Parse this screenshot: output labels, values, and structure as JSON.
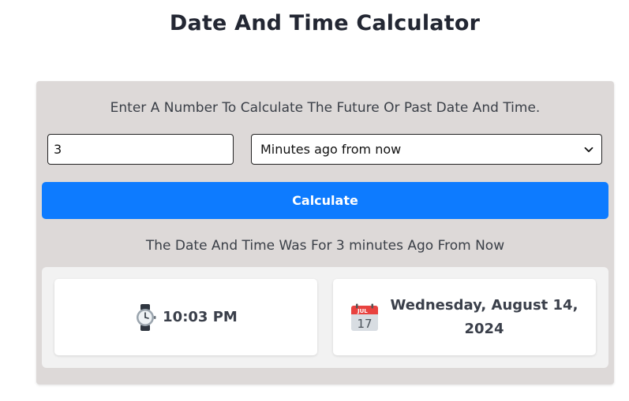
{
  "page": {
    "title": "Date And Time Calculator"
  },
  "form": {
    "instructions": "Enter A Number To Calculate The Future Or Past Date And Time.",
    "number_value": "3",
    "unit_selected": "Minutes ago from now",
    "calculate_label": "Calculate"
  },
  "result": {
    "summary": "The Date And Time Was For 3 minutes Ago From Now",
    "time": "10:03 PM",
    "date": "Wednesday, August 14, 2024",
    "calendar_month": "JUL",
    "calendar_day": "17",
    "time_icon": "watch-icon",
    "date_icon": "calendar-icon"
  },
  "colors": {
    "accent": "#0d7bff",
    "card_bg": "#ddd9d8",
    "panel_bg": "#f2f2f2",
    "calendar_red": "#e8423f"
  }
}
